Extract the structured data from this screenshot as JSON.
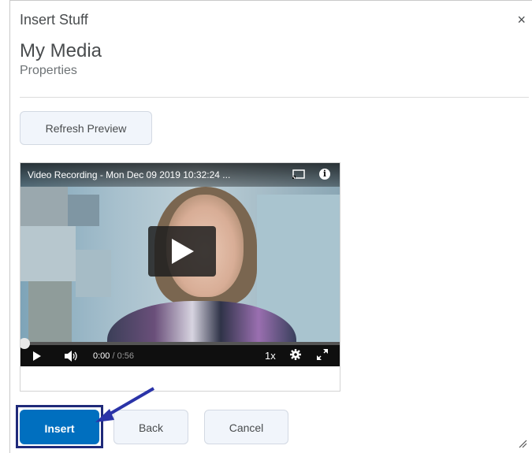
{
  "dialog": {
    "title": "Insert Stuff",
    "close_label": "×",
    "heading": "My Media",
    "subheading": "Properties"
  },
  "toolbar": {
    "refresh_label": "Refresh Preview"
  },
  "player": {
    "video_title": "Video Recording - Mon Dec 09 2019 10:32:24 ...",
    "current_time": "0:00",
    "duration": "/ 0:56",
    "speed": "1x",
    "progress_fraction": 0.0
  },
  "footer": {
    "insert_label": "Insert",
    "back_label": "Back",
    "cancel_label": "Cancel"
  },
  "colors": {
    "primary": "#006fbf",
    "highlight_border": "#1f2a7a",
    "arrow": "#2a33a8"
  },
  "icons": [
    "close-icon",
    "cast-icon",
    "info-icon",
    "play-icon",
    "volume-icon",
    "gear-icon",
    "fullscreen-icon",
    "resize-grip-icon"
  ]
}
